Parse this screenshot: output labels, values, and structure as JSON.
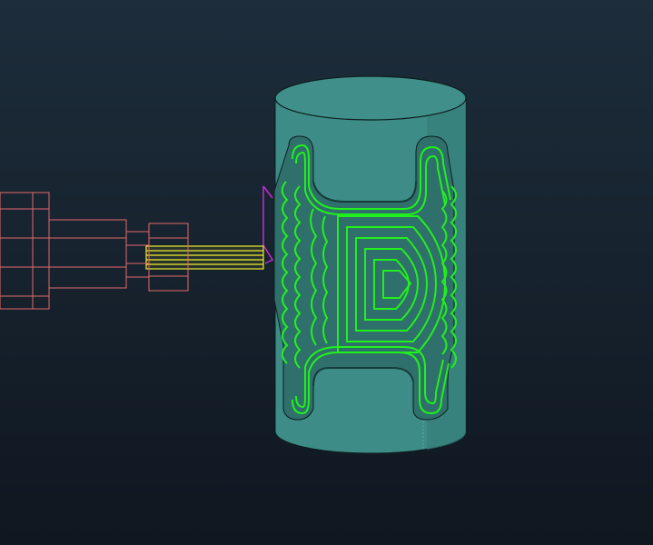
{
  "viewport": {
    "name": "cam-toolpath-3d-viewport",
    "background_top": "#1d2d3b",
    "background_bottom": "#0f1720"
  },
  "scene": {
    "stock": {
      "shape": "cylinder",
      "color": "#3f8f8a",
      "edge_color": "#0d1e1e"
    },
    "toolpath": {
      "pattern": "concentric-offset-pocket",
      "color": "#22f01c"
    },
    "tool": {
      "part": "end-mill",
      "color": "#f1ee2a"
    },
    "tool_holder": {
      "style": "wireframe",
      "color": "#e26a6a"
    },
    "lead_in": {
      "color": "#c030d0"
    }
  }
}
